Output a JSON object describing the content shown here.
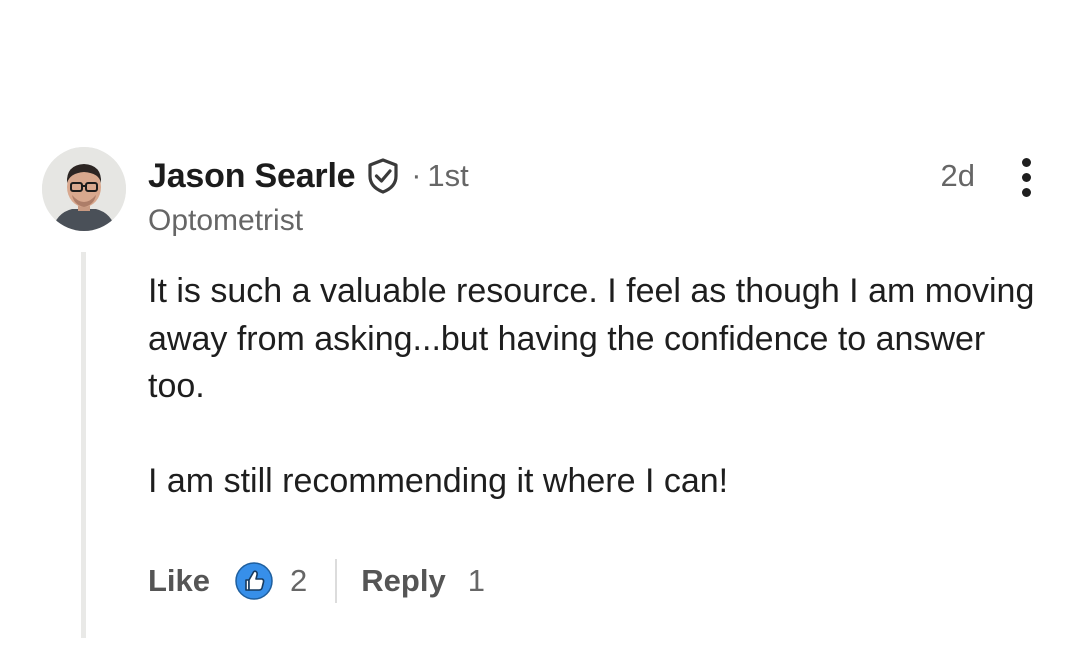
{
  "comment": {
    "author": {
      "name": "Jason Searle",
      "degree_separator": "·",
      "degree": "1st",
      "headline": "Optometrist",
      "avatar_icon": "person-photo-icon",
      "verified_icon": "verified-shield-icon"
    },
    "timestamp": "2d",
    "more_icon": "more-vertical-icon",
    "paragraphs": [
      "It is such a valuable resource. I feel as though I am moving away from asking...but having the confidence to answer too.",
      "I am still recommending it where I can!"
    ],
    "actions": {
      "like_label": "Like",
      "like_icon": "thumbs-up-reaction-icon",
      "like_count": "2",
      "reply_label": "Reply",
      "reply_count": "1"
    }
  },
  "colors": {
    "text_primary": "#1e1e1e",
    "text_secondary": "#666666",
    "reaction_blue": "#378fe9",
    "thread_line": "#e9e9e7"
  }
}
